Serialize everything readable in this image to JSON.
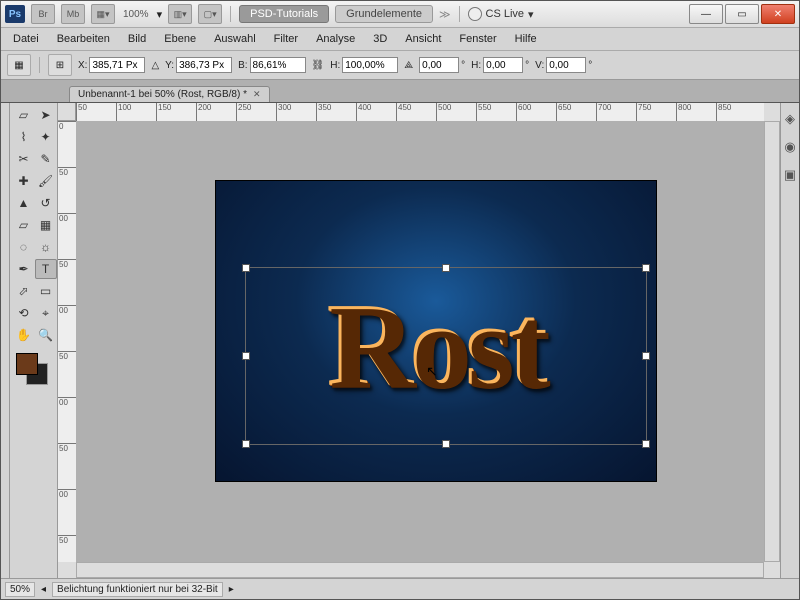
{
  "titlebar": {
    "app": "Ps",
    "br": "Br",
    "mb": "Mb",
    "zoom": "100%",
    "btn1_label": "PSD-Tutorials",
    "btn2_label": "Grundelemente",
    "cslive": "CS Live"
  },
  "menu": [
    "Datei",
    "Bearbeiten",
    "Bild",
    "Ebene",
    "Auswahl",
    "Filter",
    "Analyse",
    "3D",
    "Ansicht",
    "Fenster",
    "Hilfe"
  ],
  "options": {
    "x_label": "X:",
    "x_val": "385,71 Px",
    "y_label": "Y:",
    "y_val": "386,73 Px",
    "b_label": "B:",
    "b_val": "86,61%",
    "h_label": "H:",
    "h_val": "100,00%",
    "angle_val": "0,00",
    "h2_label": "H:",
    "h2_val": "0,00",
    "v_label": "V:",
    "v_val": "0,00",
    "deg": "°"
  },
  "doc_tab": "Unbenannt-1 bei 50% (Rost, RGB/8) *",
  "ruler_h": [
    "50",
    "100",
    "150",
    "200",
    "250",
    "300",
    "350",
    "400",
    "450",
    "500",
    "550",
    "600",
    "650",
    "700",
    "750",
    "800",
    "850"
  ],
  "ruler_v": [
    "0",
    "50",
    "00",
    "50",
    "00",
    "50",
    "00",
    "50",
    "00",
    "50"
  ],
  "canvas": {
    "text": "Rost"
  },
  "status": {
    "zoom": "50%",
    "msg": "Belichtung funktioniert nur bei 32-Bit"
  }
}
